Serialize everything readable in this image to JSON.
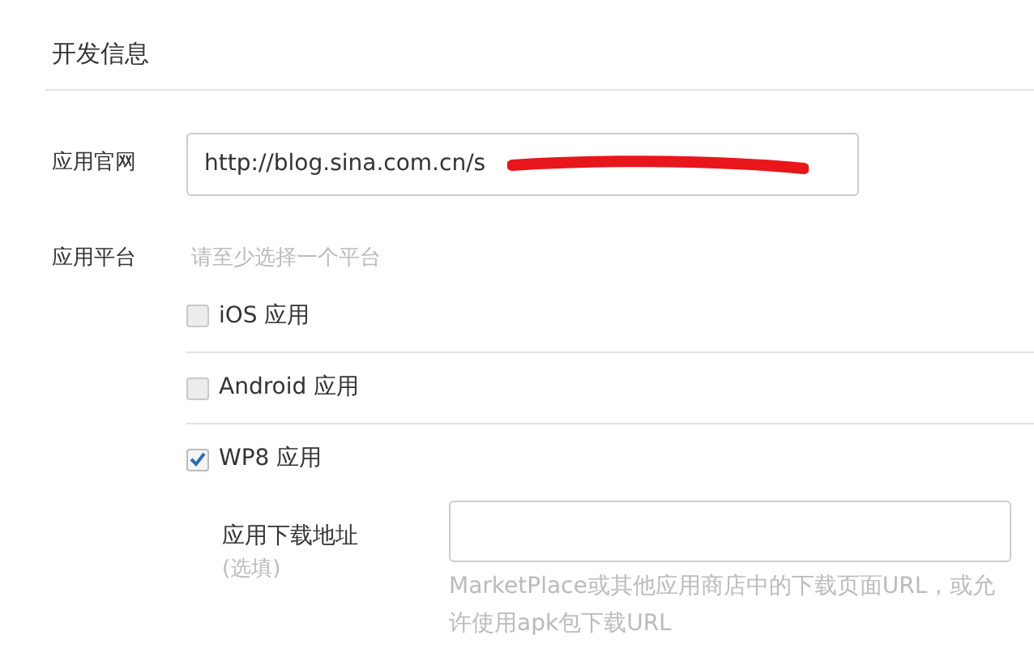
{
  "section_title": "开发信息",
  "website": {
    "label": "应用官网",
    "value": "http://blog.sina.com.cn/s",
    "redacted": true
  },
  "platform": {
    "label": "应用平台",
    "hint": "请至少选择一个平台",
    "options": [
      {
        "label": "iOS 应用",
        "checked": false
      },
      {
        "label": "Android 应用",
        "checked": false
      },
      {
        "label": "WP8 应用",
        "checked": true
      }
    ]
  },
  "download": {
    "label": "应用下载地址",
    "note": "(选填)",
    "help": "MarketPlace或其他应用商店中的下载页面URL，或允许使用apk包下载URL"
  }
}
